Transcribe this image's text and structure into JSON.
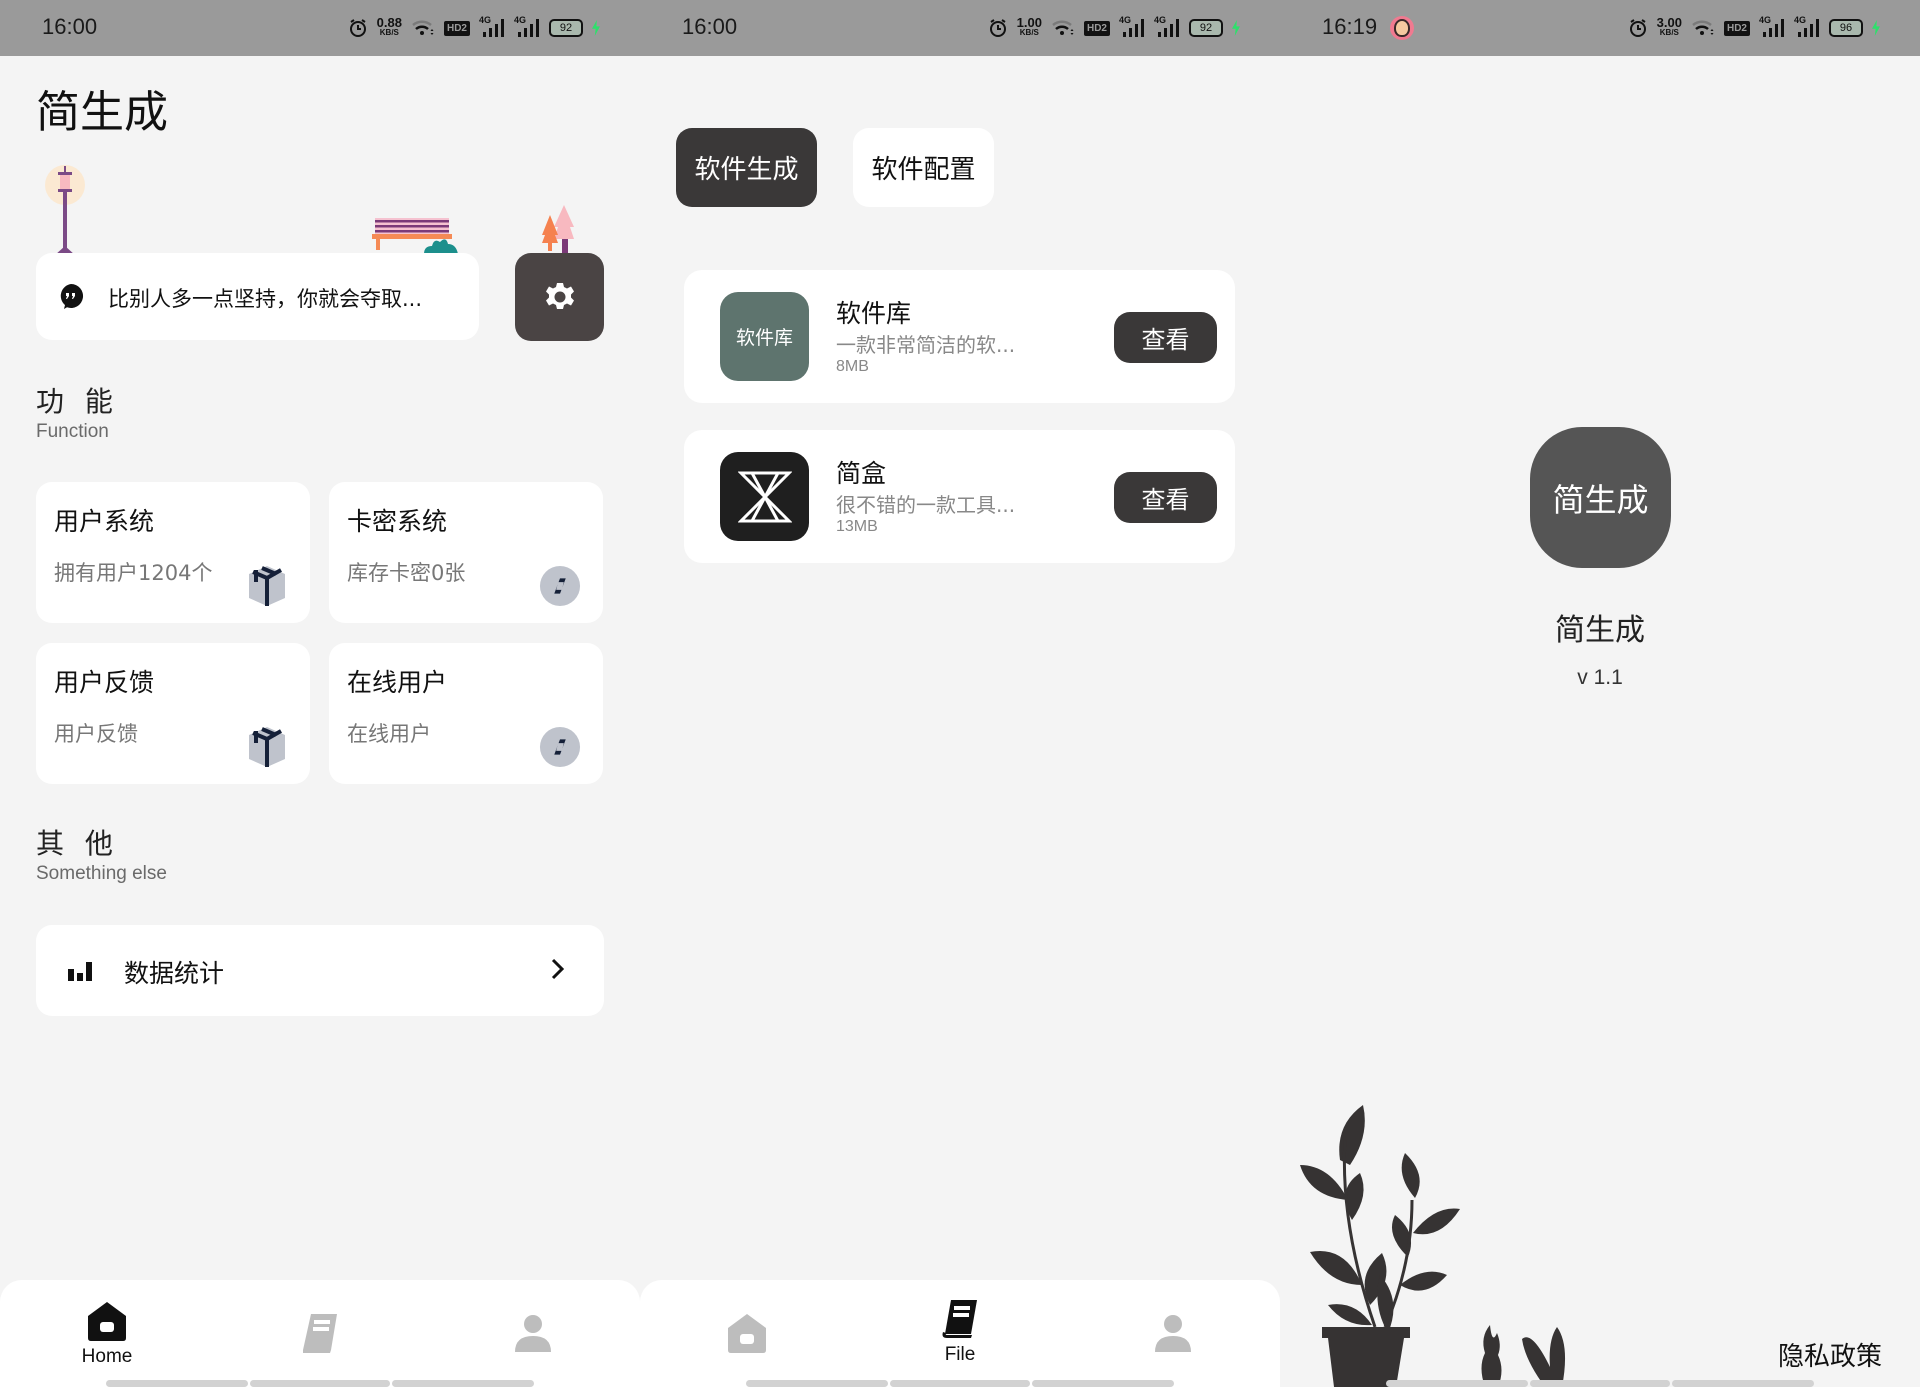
{
  "colors": {
    "status_bar_bg": "#9a9a9a",
    "page_bg": "#f4f4f4",
    "card_bg": "#ffffff",
    "dark_button": "#3a3838",
    "settings_button": "#4a4444",
    "app_icon_green": "#5e746e",
    "app_icon_dark": "#1f1f1f",
    "logo_bg": "#555555",
    "battery_bolt": "#2ee06b",
    "icon_inactive": "#bdbdbd"
  },
  "screens": [
    {
      "status_bar": {
        "time": "16:00",
        "speed_value": "0.88",
        "speed_unit": "KB/S",
        "hd_label": "HD2",
        "net1": "4G",
        "net2": "4G",
        "battery": "92"
      },
      "title": "简生成",
      "quote": {
        "icon": "quote-bubble-icon",
        "text": "比别人多一点坚持，你就会夺取..."
      },
      "settings_icon": "gear-icon",
      "function_section": {
        "title": "功 能",
        "subtitle": "Function"
      },
      "function_cards": [
        {
          "title": "用户系统",
          "subtitle": "拥有用户1204个",
          "icon": "box-icon"
        },
        {
          "title": "卡密系统",
          "subtitle": "库存卡密0张",
          "icon": "compass-icon"
        },
        {
          "title": "用户反馈",
          "subtitle": "用户反馈",
          "icon": "box-icon"
        },
        {
          "title": "在线用户",
          "subtitle": "在线用户",
          "icon": "compass-icon"
        }
      ],
      "other_section": {
        "title": "其 他",
        "subtitle": "Something else"
      },
      "stats_item": {
        "label": "数据统计",
        "icon": "bar-chart-icon"
      },
      "nav": [
        {
          "label": "Home",
          "icon": "home-icon",
          "active": true
        },
        {
          "label": "",
          "icon": "book-icon",
          "active": false
        },
        {
          "label": "",
          "icon": "user-icon",
          "active": false
        }
      ]
    },
    {
      "status_bar": {
        "time": "16:00",
        "speed_value": "1.00",
        "speed_unit": "KB/S",
        "hd_label": "HD2",
        "net1": "4G",
        "net2": "4G",
        "battery": "92"
      },
      "tabs": [
        {
          "label": "软件生成",
          "active": true
        },
        {
          "label": "软件配置",
          "active": false
        }
      ],
      "apps": [
        {
          "icon_text": "软件库",
          "name": "软件库",
          "description": "一款非常简洁的软...",
          "size": "8MB",
          "action": "查看"
        },
        {
          "icon_text": "",
          "name": "简盒",
          "description": "很不错的一款工具...",
          "size": "13MB",
          "action": "查看"
        }
      ],
      "nav": [
        {
          "label": "",
          "icon": "home-icon",
          "active": false
        },
        {
          "label": "File",
          "icon": "book-icon",
          "active": true
        },
        {
          "label": "",
          "icon": "user-icon",
          "active": false
        }
      ]
    },
    {
      "status_bar": {
        "time": "16:19",
        "speed_value": "3.00",
        "speed_unit": "KB/S",
        "hd_label": "HD2",
        "net1": "4G",
        "net2": "4G",
        "battery": "96"
      },
      "logo_text": "简生成",
      "app_name": "简生成",
      "version": "v 1.1",
      "privacy_link": "隐私政策"
    }
  ]
}
